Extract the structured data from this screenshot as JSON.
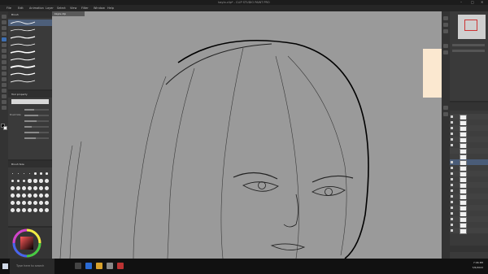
{
  "window": {
    "title": "kayla.clip* - CLIP STUDIO PAINT PRO",
    "controls": [
      "–",
      "□",
      "✕"
    ]
  },
  "menu": [
    "File",
    "Edit",
    "Animation",
    "Layer",
    "Select",
    "View",
    "Filter",
    "Window",
    "Help"
  ],
  "brush_panel": {
    "tab_label": "Brush",
    "brushes": [
      "",
      "",
      "",
      "",
      "",
      "",
      "",
      "",
      ""
    ]
  },
  "props": {
    "tab_label": "Tool property",
    "rows": [
      {
        "label": "",
        "fill": 0.4
      },
      {
        "label": "Brush Size",
        "fill": 0.55
      },
      {
        "label": "",
        "fill": 0.5
      },
      {
        "label": "",
        "fill": 0.3
      },
      {
        "label": "",
        "fill": 0.6
      },
      {
        "label": "",
        "fill": 0.45
      }
    ]
  },
  "size_panel": {
    "tab_label": "Brush Size"
  },
  "canvas": {
    "tab_label": "kayla.clip"
  },
  "layers": {
    "tab_label": "Layer",
    "rows": [
      {
        "name": "",
        "visible": true
      },
      {
        "name": "",
        "visible": true
      },
      {
        "name": "",
        "visible": true
      },
      {
        "name": "",
        "visible": true
      },
      {
        "name": "",
        "visible": true
      },
      {
        "name": "",
        "visible": true
      },
      {
        "name": "",
        "visible": false
      },
      {
        "name": "",
        "visible": false
      },
      {
        "name": "",
        "visible": true
      },
      {
        "name": "",
        "visible": true
      },
      {
        "name": "",
        "visible": true
      },
      {
        "name": "",
        "visible": true
      },
      {
        "name": "",
        "visible": true
      },
      {
        "name": "",
        "visible": true
      },
      {
        "name": "",
        "visible": true
      },
      {
        "name": "",
        "visible": true
      },
      {
        "name": "",
        "visible": true
      },
      {
        "name": "",
        "visible": true
      },
      {
        "name": "",
        "visible": true
      },
      {
        "name": "",
        "visible": true
      },
      {
        "name": "",
        "visible": true
      }
    ]
  },
  "taskbar": {
    "search_placeholder": "Type here to search",
    "time": "7:06 PM",
    "date": "7/6/2022"
  },
  "colors": {
    "accent": "#3d6fb3",
    "canvas_bg": "#9a9a9a",
    "sketch": "#3a3a3a",
    "ink": "#000000"
  }
}
